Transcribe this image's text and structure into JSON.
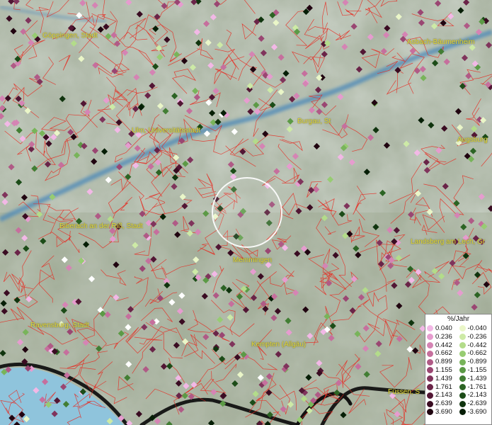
{
  "map": {
    "colors": {
      "border_lines": "#e8281e",
      "label_text": "#e6dc3c",
      "water": "#4a88b8",
      "lake": "#8fc4dc",
      "highlight_ring": "#ffffff"
    },
    "cities": [
      {
        "key": "goeppingen",
        "label": "Göppingen, Stadt"
      },
      {
        "key": "aschbach",
        "label": "Asbach-Bäumenheim"
      },
      {
        "key": "ulm",
        "label": "Ulm, Universitätsstadt"
      },
      {
        "key": "burgau",
        "label": "Burgau, St"
      },
      {
        "key": "augsburg",
        "label": "Augsburg"
      },
      {
        "key": "biberach",
        "label": "Biberach an der Riß, Stadt"
      },
      {
        "key": "landsberg",
        "label": "Landsberg am Lech, Gr"
      },
      {
        "key": "memmingen",
        "label": "Memmingen"
      },
      {
        "key": "ravensburg",
        "label": "Ravensburg, Stadt"
      },
      {
        "key": "kempten",
        "label": "Kempten (Allgäu)"
      },
      {
        "key": "fuessen",
        "label": "Füssen, S"
      }
    ]
  },
  "legend": {
    "title": "%/Jahr",
    "positive": [
      {
        "value": "0.040",
        "color": "#f2b8e6"
      },
      {
        "value": "0.236",
        "color": "#e69ccf"
      },
      {
        "value": "0.442",
        "color": "#d584b4"
      },
      {
        "value": "0.662",
        "color": "#c66f9d"
      },
      {
        "value": "0.899",
        "color": "#b05a86"
      },
      {
        "value": "1.155",
        "color": "#9a4672"
      },
      {
        "value": "1.439",
        "color": "#80345c"
      },
      {
        "value": "1.761",
        "color": "#6a2448"
      },
      {
        "value": "2.143",
        "color": "#521634"
      },
      {
        "value": "2.639",
        "color": "#3a0c22"
      },
      {
        "value": "3.690",
        "color": "#200410"
      }
    ],
    "negative": [
      {
        "value": "-0.040",
        "color": "#eaf6c8"
      },
      {
        "value": "-0.236",
        "color": "#cdeaa6"
      },
      {
        "value": "-0.442",
        "color": "#b3dc8a"
      },
      {
        "value": "-0.662",
        "color": "#97cc72"
      },
      {
        "value": "-0.899",
        "color": "#78b45a"
      },
      {
        "value": "-1.155",
        "color": "#5c9a46"
      },
      {
        "value": "-1.439",
        "color": "#427e34"
      },
      {
        "value": "-1.761",
        "color": "#2c6424"
      },
      {
        "value": "-2.143",
        "color": "#1c4c18"
      },
      {
        "value": "-2.639",
        "color": "#10340e"
      },
      {
        "value": "-3.690",
        "color": "#061e06"
      }
    ]
  }
}
